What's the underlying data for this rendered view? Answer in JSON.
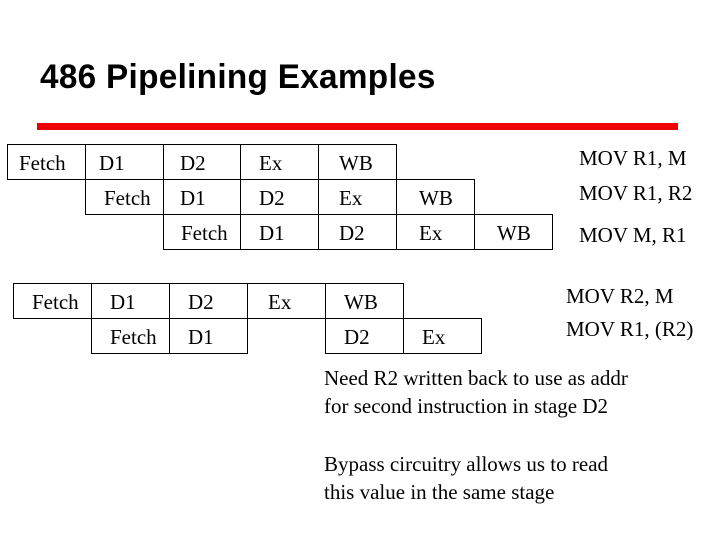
{
  "slide": {
    "title": "486 Pipelining Examples",
    "accent_color": "#ee0000",
    "example1": {
      "rows": [
        {
          "stages": [
            "Fetch",
            "D1",
            "D2",
            "Ex",
            "WB"
          ],
          "instruction": "MOV R1, M"
        },
        {
          "stages": [
            "Fetch",
            "D1",
            "D2",
            "Ex",
            "WB"
          ],
          "instruction": "MOV R1, R2"
        },
        {
          "stages": [
            "Fetch",
            "D1",
            "D2",
            "Ex",
            "WB"
          ],
          "instruction": "MOV M, R1"
        }
      ]
    },
    "example2": {
      "rows": [
        {
          "stages": [
            "Fetch",
            "D1",
            "D2",
            "Ex",
            "WB"
          ],
          "instruction": "MOV R2, M"
        },
        {
          "stages": [
            "Fetch",
            "D1",
            "",
            "D2",
            "Ex"
          ],
          "instruction": "MOV R1, (R2)"
        }
      ]
    },
    "notes": [
      [
        "Need R2 written back to use as addr",
        "for second instruction in stage D2"
      ],
      [
        "Bypass circuitry allows us to read",
        "this value in the same stage"
      ]
    ]
  }
}
